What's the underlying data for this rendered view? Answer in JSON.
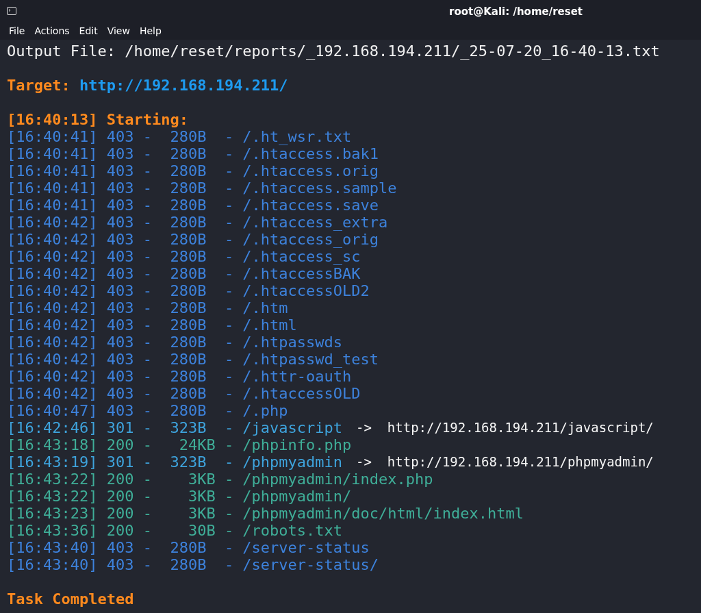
{
  "window": {
    "title": "root@Kali: /home/reset"
  },
  "menu": [
    "File",
    "Actions",
    "Edit",
    "View",
    "Help"
  ],
  "output_file": "Output File: /home/reset/reports/_192.168.194.211/_25-07-20_16-40-13.txt",
  "target": {
    "label": "Target:",
    "url": "http://192.168.194.211/"
  },
  "start": "[16:40:13] Starting:",
  "entries": [
    {
      "line": "[16:40:41] 403 -  280B  - /.ht_wsr.txt",
      "color": "#3d82dc"
    },
    {
      "line": "[16:40:41] 403 -  280B  - /.htaccess.bak1",
      "color": "#3d82dc"
    },
    {
      "line": "[16:40:41] 403 -  280B  - /.htaccess.orig",
      "color": "#3d82dc"
    },
    {
      "line": "[16:40:41] 403 -  280B  - /.htaccess.sample",
      "color": "#3d82dc"
    },
    {
      "line": "[16:40:41] 403 -  280B  - /.htaccess.save",
      "color": "#3d82dc"
    },
    {
      "line": "[16:40:42] 403 -  280B  - /.htaccess_extra",
      "color": "#3d82dc"
    },
    {
      "line": "[16:40:42] 403 -  280B  - /.htaccess_orig",
      "color": "#3d82dc"
    },
    {
      "line": "[16:40:42] 403 -  280B  - /.htaccess_sc",
      "color": "#3d82dc"
    },
    {
      "line": "[16:40:42] 403 -  280B  - /.htaccessBAK",
      "color": "#3d82dc"
    },
    {
      "line": "[16:40:42] 403 -  280B  - /.htaccessOLD2",
      "color": "#3d82dc"
    },
    {
      "line": "[16:40:42] 403 -  280B  - /.htm",
      "color": "#3d82dc"
    },
    {
      "line": "[16:40:42] 403 -  280B  - /.html",
      "color": "#3d82dc"
    },
    {
      "line": "[16:40:42] 403 -  280B  - /.htpasswds",
      "color": "#3d82dc"
    },
    {
      "line": "[16:40:42] 403 -  280B  - /.htpasswd_test",
      "color": "#3d82dc"
    },
    {
      "line": "[16:40:42] 403 -  280B  - /.httr-oauth",
      "color": "#3d82dc"
    },
    {
      "line": "[16:40:42] 403 -  280B  - /.htaccessOLD",
      "color": "#3d82dc"
    },
    {
      "line": "[16:40:47] 403 -  280B  - /.php",
      "color": "#3d82dc"
    },
    {
      "line": "[16:42:46] 301 -  323B  - /javascript",
      "redirect": "->  http://192.168.194.211/javascript/",
      "color": "#3ea3dc"
    },
    {
      "line": "[16:43:18] 200 -   24KB - /phpinfo.php",
      "color": "#3fae98"
    },
    {
      "line": "[16:43:19] 301 -  323B  - /phpmyadmin",
      "redirect": "->  http://192.168.194.211/phpmyadmin/",
      "color": "#3ea3dc"
    },
    {
      "line": "[16:43:22] 200 -    3KB - /phpmyadmin/index.php",
      "color": "#3fae98"
    },
    {
      "line": "[16:43:22] 200 -    3KB - /phpmyadmin/",
      "color": "#3fae98"
    },
    {
      "line": "[16:43:23] 200 -    3KB - /phpmyadmin/doc/html/index.html",
      "color": "#3fae98"
    },
    {
      "line": "[16:43:36] 200 -    30B - /robots.txt",
      "color": "#3fae98"
    },
    {
      "line": "[16:43:40] 403 -  280B  - /server-status",
      "color": "#3d82dc"
    },
    {
      "line": "[16:43:40] 403 -  280B  - /server-status/",
      "color": "#3d82dc"
    }
  ],
  "completion": "Task Completed"
}
